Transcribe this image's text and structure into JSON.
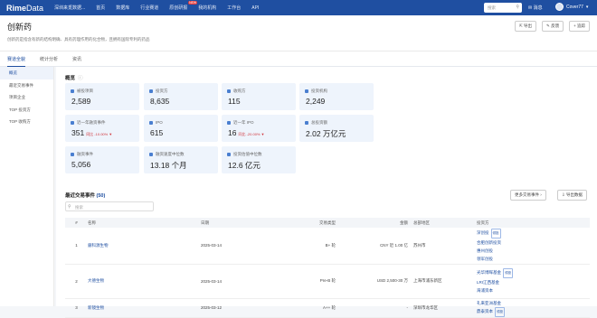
{
  "topbar": {
    "logo_bold": "Rime",
    "logo_rest": "Data",
    "nav": [
      {
        "label": "深圳来觅数据..."
      },
      {
        "label": "首页"
      },
      {
        "label": "数据库"
      },
      {
        "label": "行业赛道"
      },
      {
        "label": "原创研报",
        "badge": "NEW"
      },
      {
        "label": "我的机构"
      },
      {
        "label": "工作台"
      },
      {
        "label": "API"
      }
    ],
    "search_placeholder": "搜索",
    "messages_label": "消息",
    "user_name": "Cover77"
  },
  "header": {
    "title": "创新药",
    "description": "创新药是指含有新的结构明确、具有药理作用的化合物，且拥有国际专利的药品",
    "buttons": [
      {
        "label": "导出"
      },
      {
        "label": "反馈"
      },
      {
        "label": "追踪"
      }
    ]
  },
  "tabs": [
    {
      "label": "赛道全貌",
      "active": true
    },
    {
      "label": "统计分析"
    },
    {
      "label": "资讯"
    }
  ],
  "sidebar": {
    "items": [
      {
        "label": "概览",
        "active": true
      },
      {
        "label": "最近交易事件"
      },
      {
        "label": "项目企业"
      },
      {
        "label": "TOP 投资方"
      },
      {
        "label": "TOP 收购方"
      }
    ]
  },
  "overview": {
    "title": "概览",
    "hint": "ⓘ",
    "cards": [
      {
        "label": "被投项目",
        "value": "2,589"
      },
      {
        "label": "投资方",
        "value": "8,635"
      },
      {
        "label": "收购方",
        "value": "115"
      },
      {
        "label": "投资机构",
        "value": "2,249"
      },
      {
        "label": "近一年融资事件",
        "value": "351",
        "yoy": "同比 -10.00%"
      },
      {
        "label": "IPO",
        "value": "615"
      },
      {
        "label": "近一年 IPO",
        "value": "16",
        "yoy": "同比 -20.00%"
      },
      {
        "label": "总投资额",
        "value": "2.02 万亿元"
      },
      {
        "label": "融资事件",
        "value": "5,056"
      },
      {
        "label": "融资速度中位数",
        "value": "13.18 个月"
      },
      {
        "label": "投资估值中位数",
        "value": "12.6 亿元"
      }
    ]
  },
  "events": {
    "title": "最近交易事件",
    "count": "(50)",
    "more_label": "更多交易事件",
    "export_label": "导出数据",
    "search_placeholder": "搜索",
    "columns": [
      "#",
      "名称",
      "日期",
      "交易类型",
      "金额",
      "总部地区",
      "投资方"
    ],
    "rows": [
      {
        "no": "1",
        "name": "銀科源生物",
        "date": "2025-03-14",
        "type": "B+ 轮",
        "amount": "CNY 近 1.00 亿",
        "region": "苏州市",
        "investors": [
          {
            "name": "深创投",
            "tag": "领投"
          },
          {
            "name": "合肥创新投资"
          },
          {
            "name": "惠州创投"
          },
          {
            "name": "领军创投"
          }
        ]
      },
      {
        "no": "2",
        "name": "大德生物",
        "date": "2025-03-14",
        "type": "Pre-B 轮",
        "amount": "USD 2,500-30 万",
        "region": "上海市浦东新区",
        "investors": [
          {
            "name": "光华博晖基金",
            "tag": "领投"
          },
          {
            "name": "LRI江西基金"
          },
          {
            "name": "海浦资本"
          }
        ]
      },
      {
        "no": "3",
        "name": "新镜生物",
        "date": "2025-03-12",
        "type": "A++ 轮",
        "amount": "-",
        "region": "深圳市龙华区",
        "investors": [
          {
            "name": "礼来亚洲基金"
          },
          {
            "name": "鼎泰资本",
            "tag": "领投"
          }
        ]
      }
    ]
  }
}
